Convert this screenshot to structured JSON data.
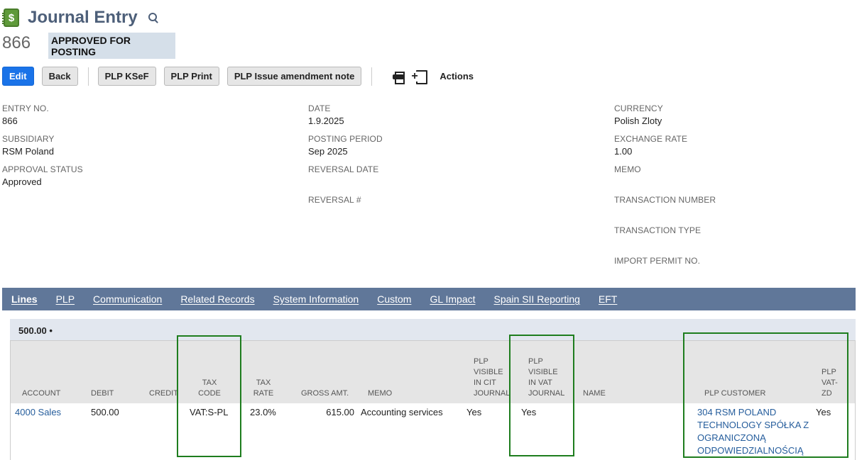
{
  "header": {
    "title": "Journal Entry",
    "record_number": "866",
    "status": "APPROVED FOR POSTING"
  },
  "toolbar": {
    "edit": "Edit",
    "back": "Back",
    "kse": "PLP KSeF",
    "print": "PLP Print",
    "amendment": "PLP Issue amendment note",
    "actions": "Actions"
  },
  "fields": {
    "entry_no": {
      "label": "ENTRY NO.",
      "value": "866"
    },
    "subsidiary": {
      "label": "SUBSIDIARY",
      "value": "RSM Poland"
    },
    "approval_status": {
      "label": "APPROVAL STATUS",
      "value": "Approved"
    },
    "date": {
      "label": "DATE",
      "value": "1.9.2025"
    },
    "posting_period": {
      "label": "POSTING PERIOD",
      "value": "Sep 2025"
    },
    "reversal_date": {
      "label": "REVERSAL DATE",
      "value": ""
    },
    "reversal_no": {
      "label": "REVERSAL #",
      "value": ""
    },
    "currency": {
      "label": "CURRENCY",
      "value": "Polish Zloty"
    },
    "exchange_rate": {
      "label": "EXCHANGE RATE",
      "value": "1.00"
    },
    "memo": {
      "label": "MEMO",
      "value": ""
    },
    "transaction_number": {
      "label": "TRANSACTION NUMBER",
      "value": ""
    },
    "transaction_type": {
      "label": "TRANSACTION TYPE",
      "value": ""
    },
    "import_permit": {
      "label": "IMPORT PERMIT NO.",
      "value": ""
    }
  },
  "tabs": [
    {
      "label": "Lines"
    },
    {
      "label": "PLP"
    },
    {
      "label": "Communication"
    },
    {
      "label": "Related Records"
    },
    {
      "label": "System Information"
    },
    {
      "label": "Custom"
    },
    {
      "label": "GL Impact"
    },
    {
      "label": "Spain SII Reporting"
    },
    {
      "label": "EFT"
    }
  ],
  "subtab": {
    "label": "500.00 •"
  },
  "lines": {
    "columns": {
      "account": "ACCOUNT",
      "debit": "DEBIT",
      "credit": "CREDIT",
      "tax_code": "TAX CODE",
      "tax_rate": "TAX RATE",
      "gross_amt": "GROSS AMT.",
      "memo": "MEMO",
      "cit": "PLP VISIBLE IN CIT JOURNAL",
      "vat": "PLP VISIBLE IN VAT JOURNAL",
      "name": "NAME",
      "customer": "PLP CUSTOMER",
      "vat_zd": "PLP VAT-ZD"
    },
    "rows": [
      {
        "account": "4000 Sales",
        "debit": "500.00",
        "credit": "",
        "tax_code": "VAT:S-PL",
        "tax_rate": "23.0%",
        "gross_amt": "615.00",
        "memo": "Accounting services",
        "cit": "Yes",
        "vat": "Yes",
        "name": "",
        "customer": "304 RSM POLAND TECHNOLOGY SPÓŁKA Z OGRANICZONĄ ODPOWIEDZIALNOŚCIĄ",
        "vat_zd": "Yes"
      }
    ]
  }
}
